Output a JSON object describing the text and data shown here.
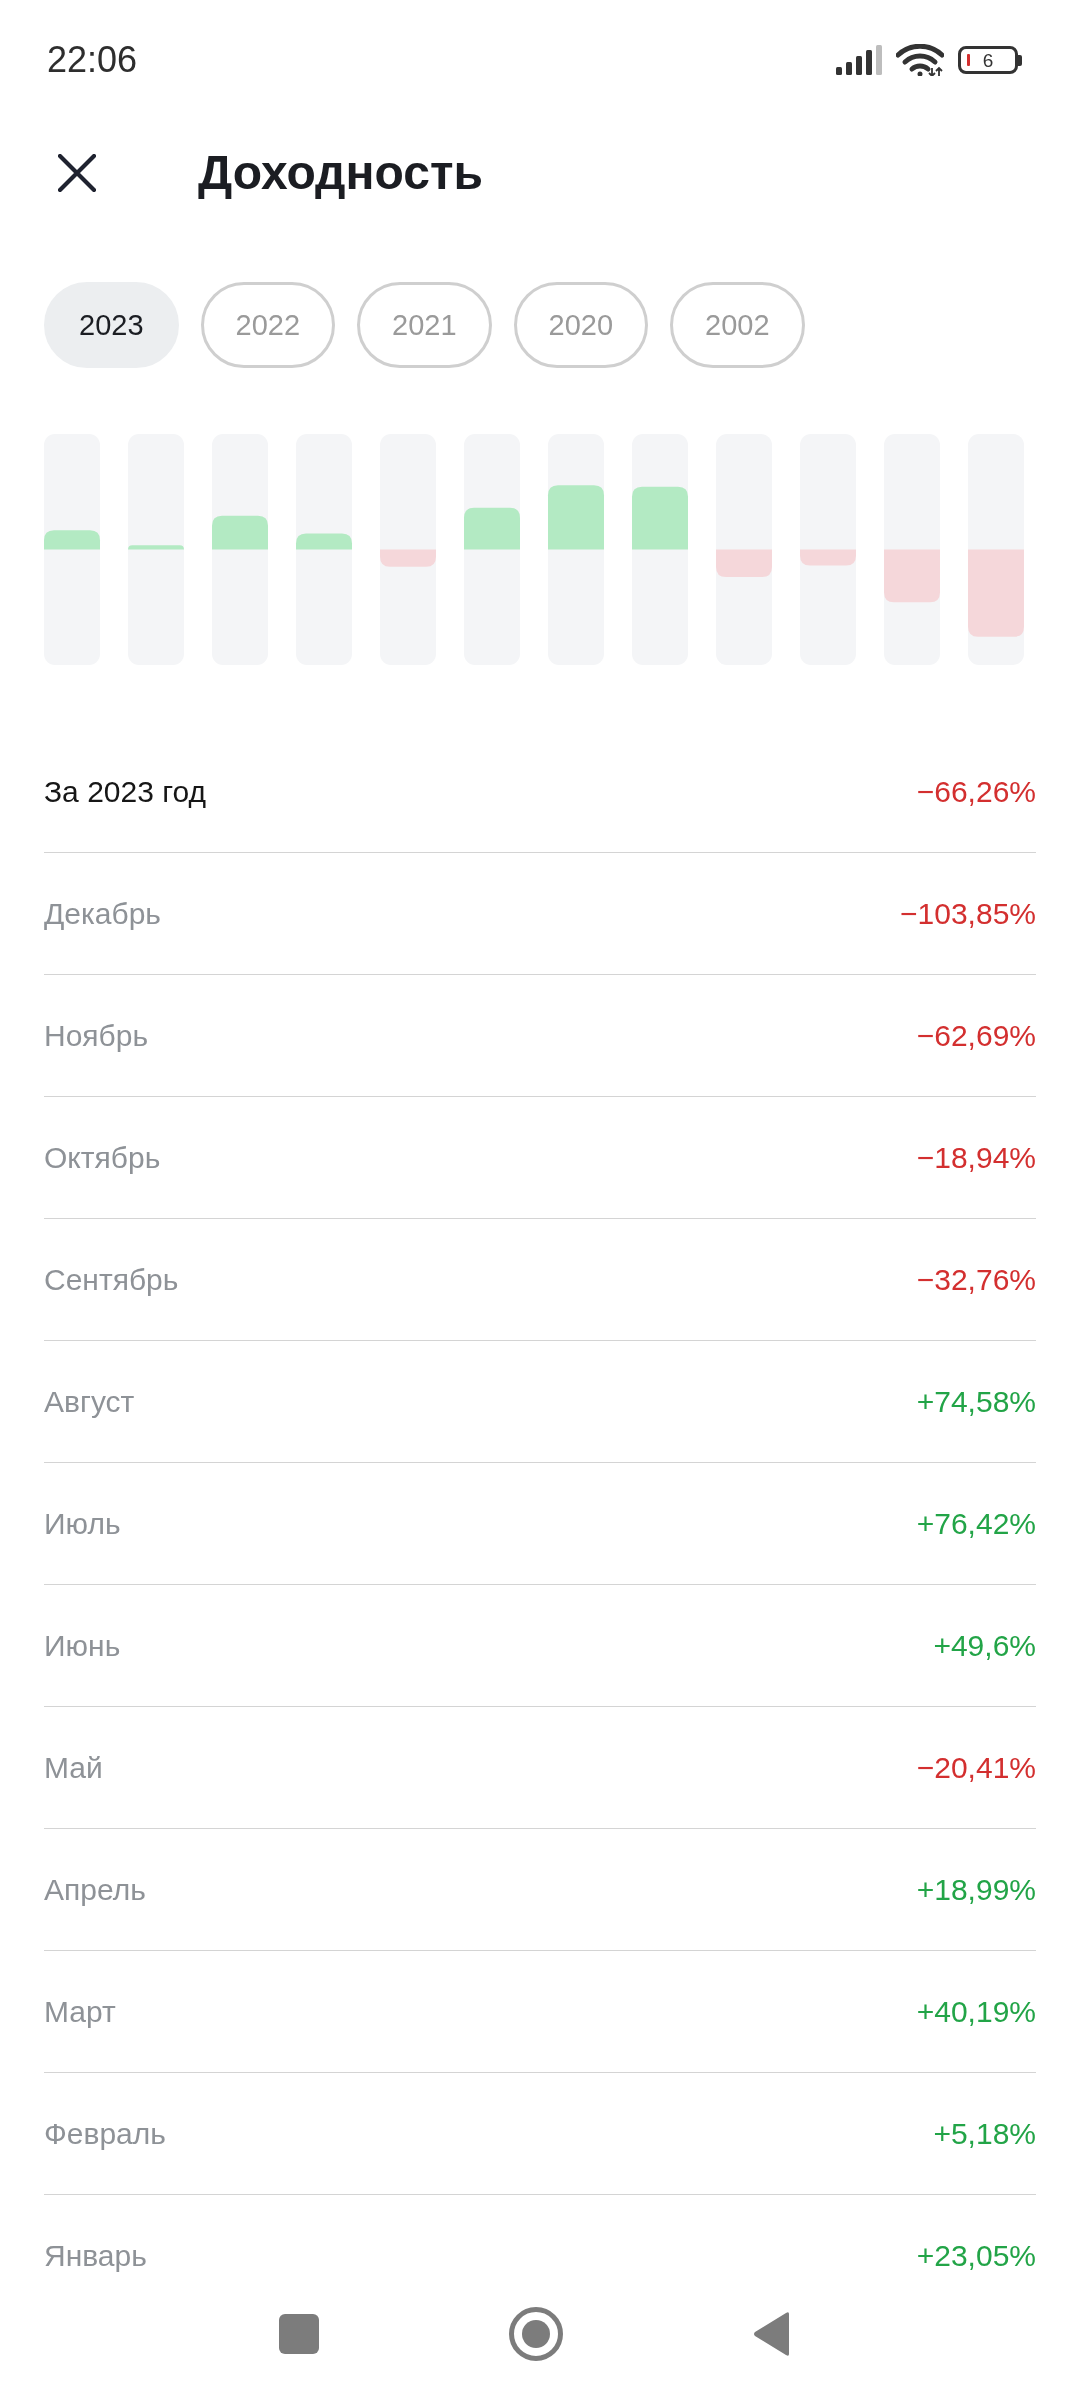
{
  "status_bar": {
    "time": "22:06",
    "battery": "6"
  },
  "header": {
    "title": "Доходность"
  },
  "year_tabs": [
    {
      "label": "2023",
      "selected": true
    },
    {
      "label": "2022",
      "selected": false
    },
    {
      "label": "2021",
      "selected": false
    },
    {
      "label": "2020",
      "selected": false
    },
    {
      "label": "2002",
      "selected": false
    }
  ],
  "total": {
    "label": "За 2023 год",
    "value": "−66,26%",
    "color": "#d32f2f"
  },
  "months": [
    {
      "label": "Декабрь",
      "value": "−103,85%",
      "color": "#d32f2f"
    },
    {
      "label": "Ноябрь",
      "value": "−62,69%",
      "color": "#d32f2f"
    },
    {
      "label": "Октябрь",
      "value": "−18,94%",
      "color": "#d32f2f"
    },
    {
      "label": "Сентябрь",
      "value": "−32,76%",
      "color": "#d32f2f"
    },
    {
      "label": "Август",
      "value": "+74,58%",
      "color": "#22a447"
    },
    {
      "label": "Июль",
      "value": "+76,42%",
      "color": "#22a447"
    },
    {
      "label": "Июнь",
      "value": "+49,6%",
      "color": "#22a447"
    },
    {
      "label": "Май",
      "value": "−20,41%",
      "color": "#d32f2f"
    },
    {
      "label": "Апрель",
      "value": "+18,99%",
      "color": "#22a447"
    },
    {
      "label": "Март",
      "value": "+40,19%",
      "color": "#22a447"
    },
    {
      "label": "Февраль",
      "value": "+5,18%",
      "color": "#22a447"
    },
    {
      "label": "Январь",
      "value": "+23,05%",
      "color": "#22a447"
    }
  ]
}
